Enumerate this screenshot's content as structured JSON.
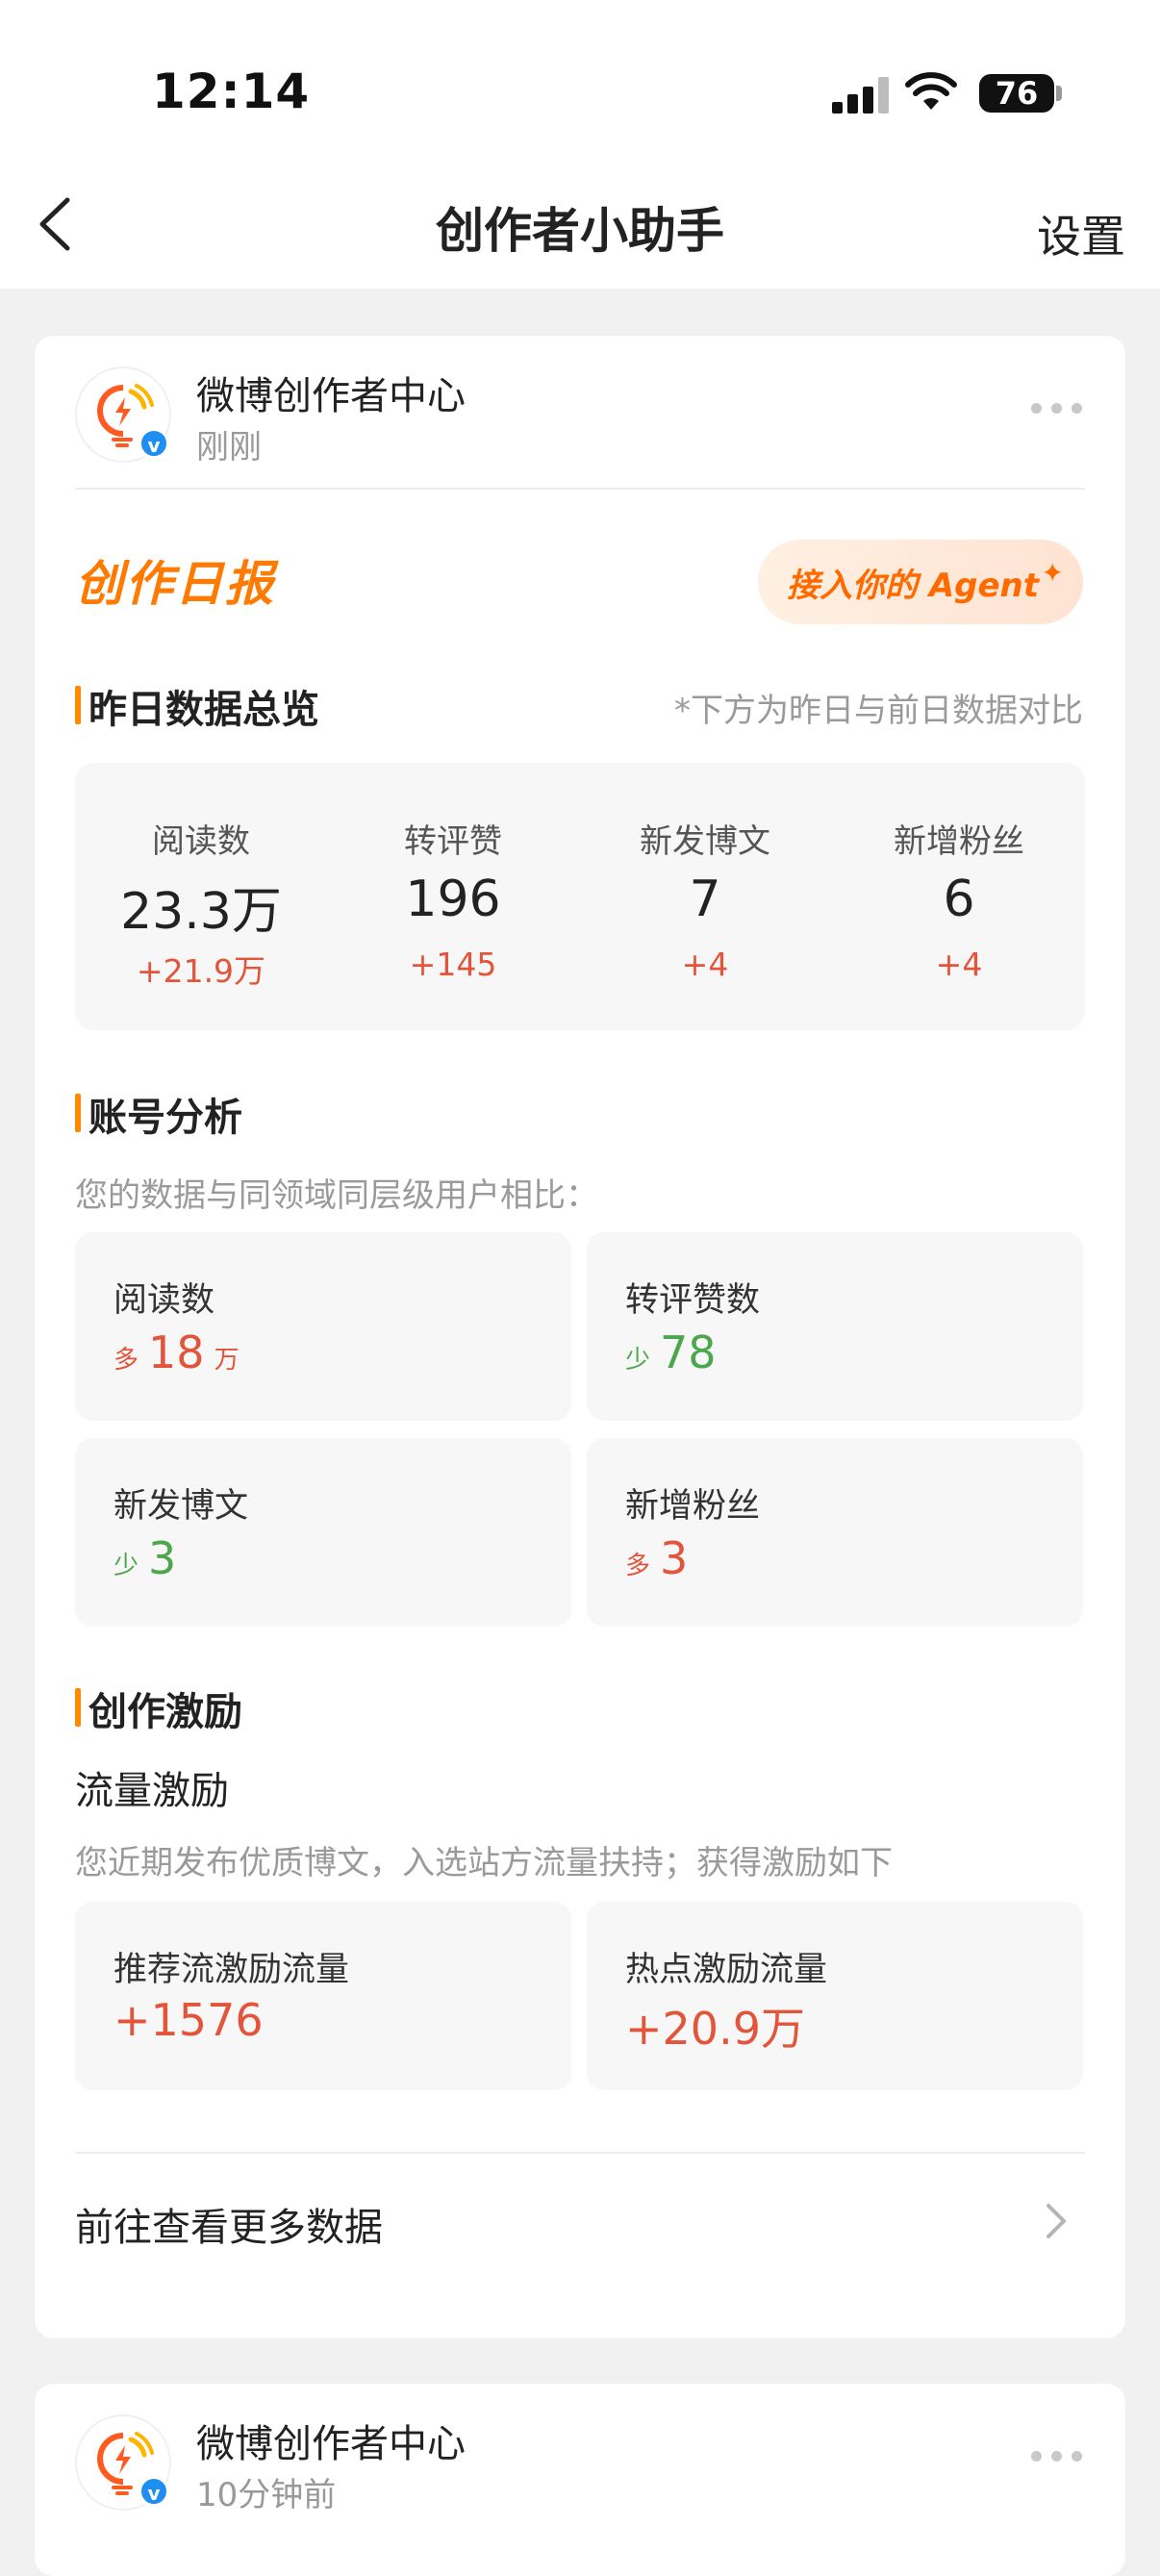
{
  "status_bar": {
    "time": "12:14",
    "battery": "76"
  },
  "nav": {
    "title": "创作者小助手",
    "settings_label": "设置"
  },
  "post": {
    "author": "微博创作者中心",
    "time": "刚刚",
    "verified_mark": "v",
    "report_title": "创作日报",
    "agent_button": "接入你的 Agent",
    "overview": {
      "heading": "昨日数据总览",
      "note": "*下方为昨日与前日数据对比",
      "items": [
        {
          "label": "阅读数",
          "value": "23.3万",
          "delta": "+21.9万"
        },
        {
          "label": "转评赞",
          "value": "196",
          "delta": "+145"
        },
        {
          "label": "新发博文",
          "value": "7",
          "delta": "+4"
        },
        {
          "label": "新增粉丝",
          "value": "6",
          "delta": "+4"
        }
      ]
    },
    "analysis": {
      "heading": "账号分析",
      "note": "您的数据与同领域同层级用户相比：",
      "items": [
        {
          "label": "阅读数",
          "prefix": "多",
          "value": "18",
          "unit": "万"
        },
        {
          "label": "转评赞数",
          "prefix": "少",
          "value": "78",
          "unit": ""
        },
        {
          "label": "新发博文",
          "prefix": "少",
          "value": "3",
          "unit": ""
        },
        {
          "label": "新增粉丝",
          "prefix": "多",
          "value": "3",
          "unit": ""
        }
      ]
    },
    "incentive": {
      "heading": "创作激励",
      "subheading": "流量激励",
      "note": "您近期发布优质博文，入选站方流量扶持；获得激励如下",
      "items": [
        {
          "label": "推荐流激励流量",
          "value": "+1576"
        },
        {
          "label": "热点激励流量",
          "value": "+20.9万"
        }
      ]
    },
    "more_link": "前往查看更多数据"
  },
  "post2": {
    "author": "微博创作者中心",
    "time": "10分钟前",
    "verified_mark": "v"
  },
  "colors": {
    "accent": "#ff7a00",
    "increase": "#e2553b",
    "decrease": "#4ca64c",
    "verified": "#1f8ef1"
  }
}
